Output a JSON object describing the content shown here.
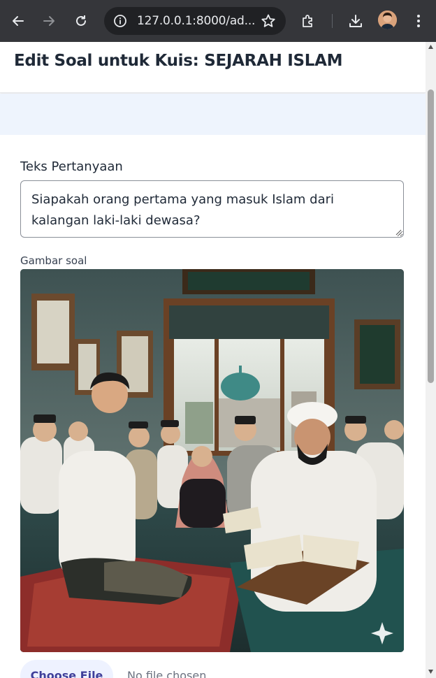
{
  "browser": {
    "url": "127.0.0.1:8000/ad...",
    "icons": [
      "back-icon",
      "forward-icon",
      "reload-icon",
      "site-info-icon",
      "bookmark-star-icon",
      "extensions-icon",
      "download-icon",
      "profile-avatar",
      "menu-icon"
    ]
  },
  "header": {
    "title": "Edit Soal untuk Kuis: SEJARAH ISLAM"
  },
  "form": {
    "question_label": "Teks Pertanyaan",
    "question_value": "Siapakah orang pertama yang masuk Islam dari kalangan laki-laki dewasa?",
    "image_label": "Gambar soal",
    "file_button_label": "Choose File",
    "file_status": "No file chosen"
  },
  "colors": {
    "chrome_bg": "#35363a",
    "omnibox_bg": "#202124",
    "band_bg": "#eef4fd",
    "file_button_bg": "#eef2ff",
    "file_button_text": "#3f3f9a"
  }
}
